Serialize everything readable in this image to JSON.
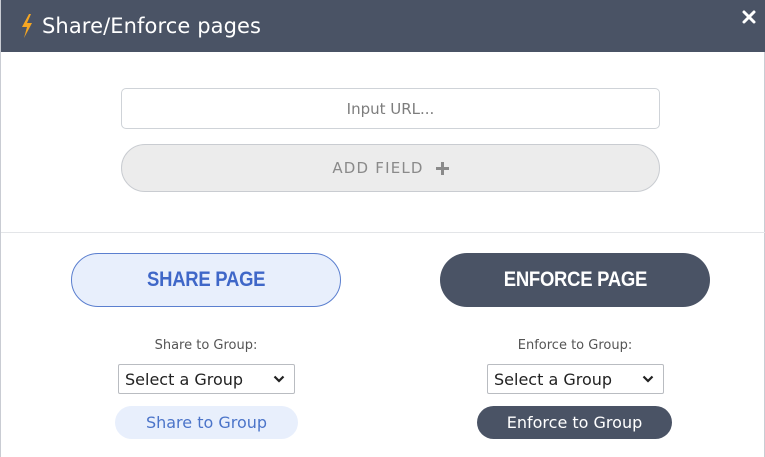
{
  "header": {
    "title": "Share/Enforce pages",
    "bolt_color": "#f5a623",
    "bar_color": "#4a5365"
  },
  "url_input": {
    "placeholder": "Input URL...",
    "value": ""
  },
  "add_field": {
    "label": "ADD FIELD",
    "icon": "plus-icon"
  },
  "share": {
    "page_button_label": "SHARE PAGE",
    "group_label": "Share to Group:",
    "select_value": "Select a Group",
    "group_button_label": "Share to Group",
    "accent": "#3f67c8"
  },
  "enforce": {
    "page_button_label": "ENFORCE PAGE",
    "group_label": "Enforce to Group:",
    "select_value": "Select a Group",
    "group_button_label": "Enforce to Group",
    "accent": "#4a5365"
  }
}
